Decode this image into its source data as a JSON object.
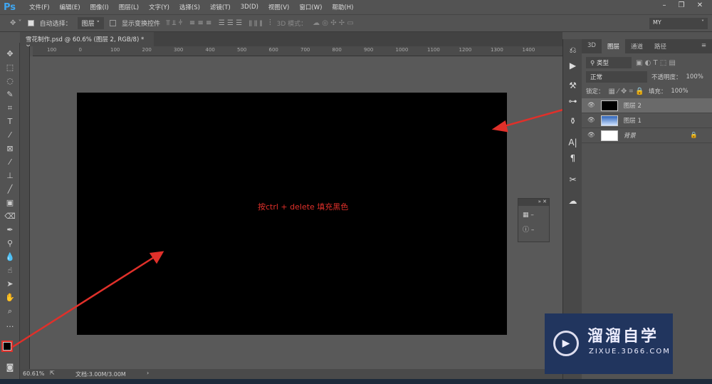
{
  "app": {
    "logo": "Ps",
    "menus": [
      "文件(F)",
      "编辑(E)",
      "图像(I)",
      "图层(L)",
      "文字(Y)",
      "选择(S)",
      "滤镜(T)",
      "3D(D)",
      "视图(V)",
      "窗口(W)",
      "帮助(H)"
    ],
    "window_buttons": [
      "–",
      "❐",
      "✕"
    ]
  },
  "options": {
    "auto_select_label": "自动选择：",
    "auto_select_value": "图层",
    "show_transform_label": "显示变换控件",
    "mode_3d_label": "3D 模式：",
    "workspace": "MY"
  },
  "document": {
    "tab_title": "雪花制作.psd @ 60.6% (图层 2, RGB/8) *",
    "close": "×",
    "note": "按ctrl + delete 填充黑色",
    "fill_color": "#000000"
  },
  "ruler": {
    "x_ticks": [
      "100",
      "0",
      "100",
      "200",
      "300",
      "400",
      "500",
      "600",
      "700",
      "800",
      "900",
      "1000",
      "1100",
      "1200",
      "1300",
      "1400"
    ]
  },
  "status": {
    "zoom": "60.61%",
    "doc_size": "文档:3.00M/3.00M",
    "arrow": "›"
  },
  "layers_panel": {
    "tabs": [
      "3D",
      "图层",
      "通道",
      "路径"
    ],
    "active_tab": "图层",
    "filter": "类型",
    "blend_mode": "正常",
    "opacity_label": "不透明度：",
    "opacity": "100%",
    "lock_label": "锁定：",
    "fill_label": "填充：",
    "fill": "100%",
    "layers": [
      {
        "name": "图层 2",
        "thumb": "#000000",
        "selected": true
      },
      {
        "name": "图层 1",
        "thumb": "#4a80c8",
        "selected": false
      },
      {
        "name": "背景",
        "thumb": "#ffffff",
        "selected": false,
        "locked": true
      }
    ]
  },
  "mini_panel": {
    "items": [
      "–",
      "–"
    ]
  },
  "colors": {
    "foreground": "#000000",
    "background": "#ffffff",
    "annotation": "#e0302a"
  },
  "watermark": {
    "title": "溜溜自学",
    "url": "ZIXUE.3D66.COM"
  }
}
